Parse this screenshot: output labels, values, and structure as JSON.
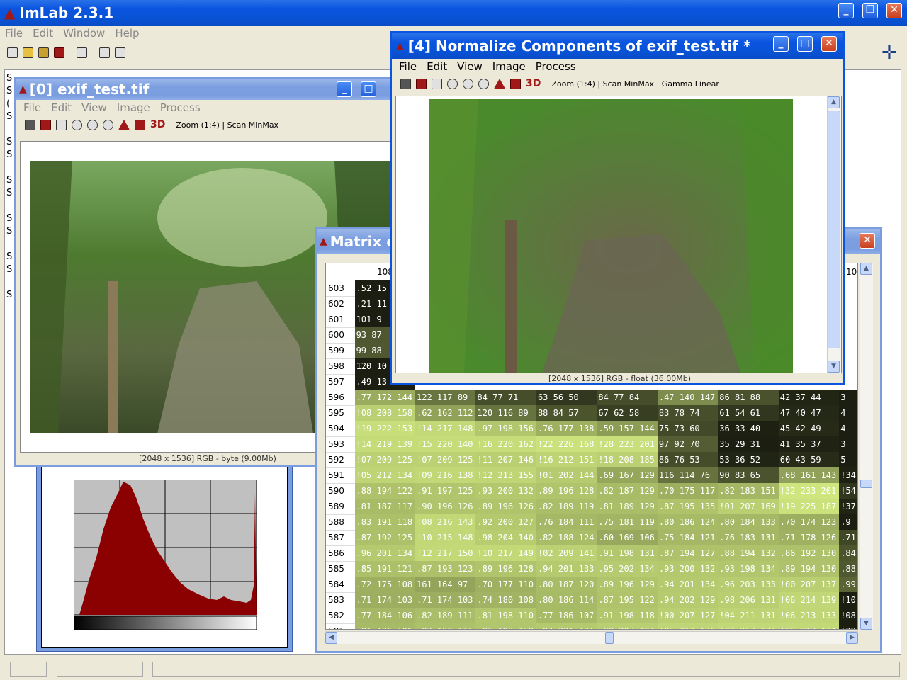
{
  "app": {
    "title": "ImLab 2.3.1",
    "menu": [
      "File",
      "Edit",
      "Window",
      "Help"
    ]
  },
  "window_exif": {
    "title": "[0] exif_test.tif",
    "menu": [
      "File",
      "Edit",
      "View",
      "Image",
      "Process"
    ],
    "toolbar_text": "Zoom (1:4) | Scan MinMax",
    "status": "[2048 x 1536] RGB - byte (9.00Mb)"
  },
  "window_norm": {
    "title": "[4] Normalize Components of exif_test.tif *",
    "menu": [
      "File",
      "Edit",
      "View",
      "Image",
      "Process"
    ],
    "toolbar_text": "Zoom (1:4) | Scan MinMax | Gamma Linear",
    "status": "[2048 x 1536] RGB - float (36.00Mb)"
  },
  "window_matrix": {
    "title": "Matrix o",
    "col_header": "108",
    "col_header_right": "10",
    "rows": [
      {
        "r": "603",
        "c": [
          ".52  15"
        ]
      },
      {
        "r": "602",
        "c": [
          ".21  11"
        ]
      },
      {
        "r": "601",
        "c": [
          "101  9"
        ]
      },
      {
        "r": "600",
        "c": [
          " 93  87"
        ]
      },
      {
        "r": "599",
        "c": [
          " 99  88"
        ]
      },
      {
        "r": "598",
        "c": [
          "120  10"
        ]
      },
      {
        "r": "597",
        "c": [
          ".49  13"
        ]
      },
      {
        "r": "596",
        "c": [
          ".77 172 144",
          "122 117  89",
          " 84  77  71",
          " 63  56  50",
          " 84  77  84",
          ".47 140 147",
          " 86  81  88",
          " 42  37  44",
          "3"
        ]
      },
      {
        "r": "595",
        "c": [
          "!08 208 158",
          ".62 162 112",
          "120 116  89",
          " 88  84  57",
          " 67  62  58",
          " 83  78  74",
          " 61  54  61",
          " 47  40  47",
          "4"
        ]
      },
      {
        "r": "594",
        "c": [
          "!19 222 153",
          "!14 217 148",
          ".97 198 156",
          ".76 177 138",
          ".59 157 144",
          " 75  73  60",
          " 36  33  40",
          " 45  42  49",
          "4"
        ]
      },
      {
        "r": "593",
        "c": [
          "!14 219 139",
          "!15 220 140",
          "!16 220 162",
          "!22 226 168",
          "!28 223 201",
          " 97  92  70",
          " 35  29  31",
          " 41  35  37",
          "3"
        ]
      },
      {
        "r": "592",
        "c": [
          "!07 209 125",
          "!07 209 125",
          "!11 207 146",
          "!16 212 151",
          "!18 208 185",
          " 86  76  53",
          " 53  36  52",
          " 60  43  59",
          "5"
        ]
      },
      {
        "r": "591",
        "c": [
          "!05 212 134",
          "!09 216 138",
          "!12 213 155",
          "!01 202 144",
          ".69 167 129",
          "116 114  76",
          " 90  83  65",
          ".68 161 143",
          "!34"
        ]
      },
      {
        "r": "590",
        "c": [
          ".88 194 122",
          ".91 197 125",
          ".93 200 132",
          ".89 196 128",
          ".82 187 129",
          ".70 175 117",
          ".82 183 151",
          "!32 233 201",
          "!54"
        ]
      },
      {
        "r": "589",
        "c": [
          ".81 187 117",
          ".90 196 126",
          ".89 196 126",
          ".82 189 119",
          ".81 189 129",
          ".87 195 135",
          "!01 207 169",
          "!19 225 187",
          "!37"
        ]
      },
      {
        "r": "588",
        "c": [
          ".83 191 118",
          "!08 216 143",
          ".92 200 127",
          ".76 184 111",
          ".75 181 119",
          ".80 186 124",
          ".80 184 133",
          ".70 174 123",
          ".9"
        ]
      },
      {
        "r": "587",
        "c": [
          ".87 192 125",
          "!10 215 148",
          ".98 204 140",
          ".82 188 124",
          ".60 169 106",
          ".75 184 121",
          ".76 183 131",
          ".71 178 126",
          ".71"
        ]
      },
      {
        "r": "586",
        "c": [
          ".96 201 134",
          "!12 217 150",
          "!10 217 149",
          "!02 209 141",
          ".91 198 131",
          ".87 194 127",
          ".88 194 132",
          ".86 192 130",
          ".84"
        ]
      },
      {
        "r": "585",
        "c": [
          ".85 191 121",
          ".87 193 123",
          ".89 196 128",
          ".94 201 133",
          ".95 202 134",
          ".93 200 132",
          ".93 198 134",
          ".89 194 130",
          ".88"
        ]
      },
      {
        "r": "584",
        "c": [
          ".72 175 108",
          "161 164  97",
          ".70 177 110",
          ".80 187 120",
          ".89 196 129",
          ".94 201 134",
          ".96 203 133",
          "!00 207 137",
          ".99"
        ]
      },
      {
        "r": "583",
        "c": [
          ".71 174 103",
          ".71 174 103",
          ".74 180 108",
          ".80 186 114",
          ".87 195 122",
          ".94 202 129",
          ".98 206 131",
          "!06 214 139",
          "!10"
        ]
      },
      {
        "r": "582",
        "c": [
          ".77 184 106",
          ".82 189 111",
          ".81 198 110",
          ".77 186 107",
          ".91 198 118",
          "!00 207 127",
          "!04 211 131",
          "!06 213 133",
          "!08"
        ]
      },
      {
        "r": "581",
        "c": [
          ".81 186 106",
          ".83 192 111",
          ".81 198 118",
          ".94 201 121",
          ".98 207 124",
          "!05 213 130",
          "!09 217 134",
          "!09 217 134",
          "!09"
        ]
      }
    ]
  },
  "colors": {
    "titlebar": "#0a54e0",
    "menu_bg": "#ece9d8",
    "hist_fill": "#8b0000",
    "matrix_green": "#c8cc84"
  }
}
